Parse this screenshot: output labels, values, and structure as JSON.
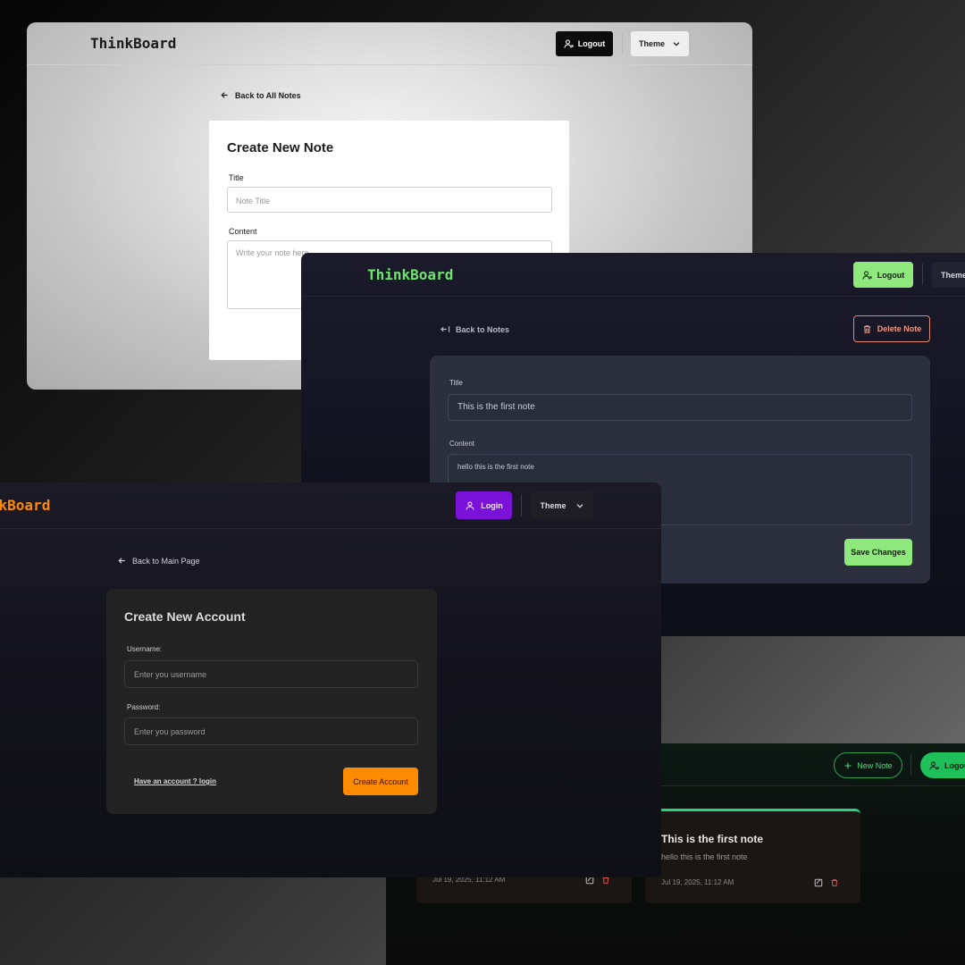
{
  "colors": {
    "light_brand": "#1b1b1b",
    "green_brand": "#6ee46c",
    "orange_brand": "#ff8a00",
    "purple_login": "#7a12d8",
    "delete_red": "#ef9a84"
  },
  "w1": {
    "brand": "ThinkBoard",
    "logout_label": "Logout",
    "theme_label": "Theme",
    "back_label": "Back to All Notes",
    "card_title": "Create New Note",
    "title_label": "Title",
    "title_placeholder": "Note Title",
    "content_label": "Content",
    "content_placeholder": "Write your note here..."
  },
  "w2": {
    "brand": "ThinkBoard",
    "logout_label": "Logout",
    "theme_label": "Theme",
    "back_label": "Back to Notes",
    "delete_label": "Delete Note",
    "title_label": "Title",
    "title_value": "This is the first note",
    "content_label": "Content",
    "content_value": "hello this is the first note",
    "save_label": "Save Changes"
  },
  "w3": {
    "brand": "ThinkBoard",
    "login_label": "Login",
    "theme_label": "Theme",
    "back_label": "Back to Main Page",
    "card_title": "Create New Account",
    "username_label": "Username:",
    "username_placeholder": "Enter you username",
    "password_label": "Password:",
    "password_placeholder": "Enter you password",
    "have_account_link": "Have an account ? login",
    "create_label": "Create Account"
  },
  "w4": {
    "new_note_label": "New Note",
    "logout_label": "Logout",
    "notes": [
      {
        "title": "",
        "body": "",
        "date": "Jul 19, 2025, 11:12 AM"
      },
      {
        "title": "This is the first note",
        "body": "hello this is the first note",
        "date": "Jul 19, 2025, 11:12 AM"
      }
    ]
  }
}
